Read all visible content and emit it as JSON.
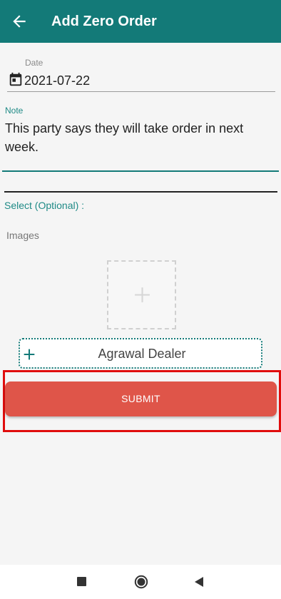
{
  "appbar": {
    "title": "Add Zero Order",
    "back_icon": "arrow-back-icon",
    "color": "#137a78"
  },
  "form": {
    "date": {
      "label": "Date",
      "value": "2021-07-22",
      "icon": "calendar-icon"
    },
    "note": {
      "label": "Note",
      "value": "This party says they will take order in next week."
    },
    "select_label": "Select (Optional) :",
    "images_label": "Images",
    "image_add_icon": "plus-icon",
    "dealer": {
      "name": "Agrawal Dealer",
      "icon": "plus-icon"
    },
    "submit_label": "SUBMIT",
    "submit_color": "#df5549"
  },
  "navbar": {
    "recents_icon": "square-icon",
    "home_icon": "circle-icon",
    "back_icon": "triangle-back-icon"
  }
}
